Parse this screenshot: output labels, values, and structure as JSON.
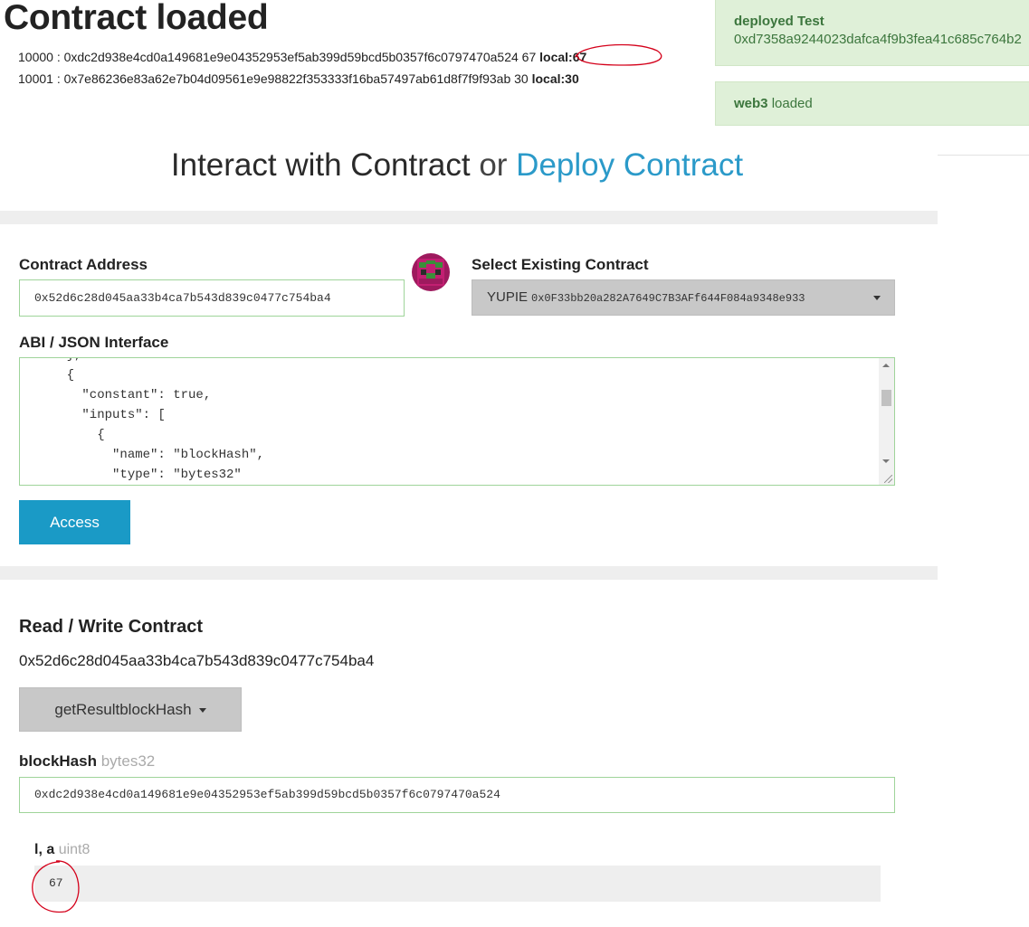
{
  "header": {
    "title": "Contract loaded",
    "rows": [
      {
        "id": "10000",
        "hash": "0xdc2d938e4cd0a149681e9e04352953ef5ab399d59bcd5b0357f6c0797470a524",
        "value": "67",
        "local": "local:67"
      },
      {
        "id": "10001",
        "hash": "0x7e86236e83a62e7b04d09561e9e98822f353333f16ba57497ab61d8f7f9f93ab",
        "value": "30",
        "local": "local:30"
      }
    ]
  },
  "alerts": {
    "deployed_title": "deployed Test",
    "deployed_hash": "0xd7358a9244023dafca4f9b3fea41c685c764b2",
    "web3_bold": "web3",
    "web3_text": "loaded"
  },
  "nav": {
    "interact": "Interact with Contract",
    "or": "or",
    "deploy": "Deploy Contract"
  },
  "form": {
    "contract_address_label": "Contract Address",
    "contract_address_value": "0x52d6c28d045aa33b4ca7b543d839c0477c754ba4",
    "select_label": "Select Existing Contract",
    "select_name": "YUPIE",
    "select_address": "0x0F33bb20a282A7649C7B3AFf644F084a9348e933",
    "abi_label": "ABI / JSON Interface",
    "abi_text": "    },\n    {\n      \"constant\": true,\n      \"inputs\": [\n        {\n          \"name\": \"blockHash\",\n          \"type\": \"bytes32\"",
    "access_label": "Access"
  },
  "readwrite": {
    "title": "Read / Write Contract",
    "address": "0x52d6c28d045aa33b4ca7b543d839c0477c754ba4",
    "method": "getResultblockHash",
    "param_name": "blockHash",
    "param_type": "bytes32",
    "param_value": "0xdc2d938e4cd0a149681e9e04352953ef5ab399d59bcd5b0357f6c0797470a524",
    "output_name": "l, a",
    "output_type": "uint8",
    "output_value": "67"
  },
  "colors": {
    "accent": "#2b9ac9",
    "button": "#1a9ac6",
    "success_bg": "#dff0d8",
    "success_text": "#3c763d",
    "annotation": "#d4001a"
  }
}
